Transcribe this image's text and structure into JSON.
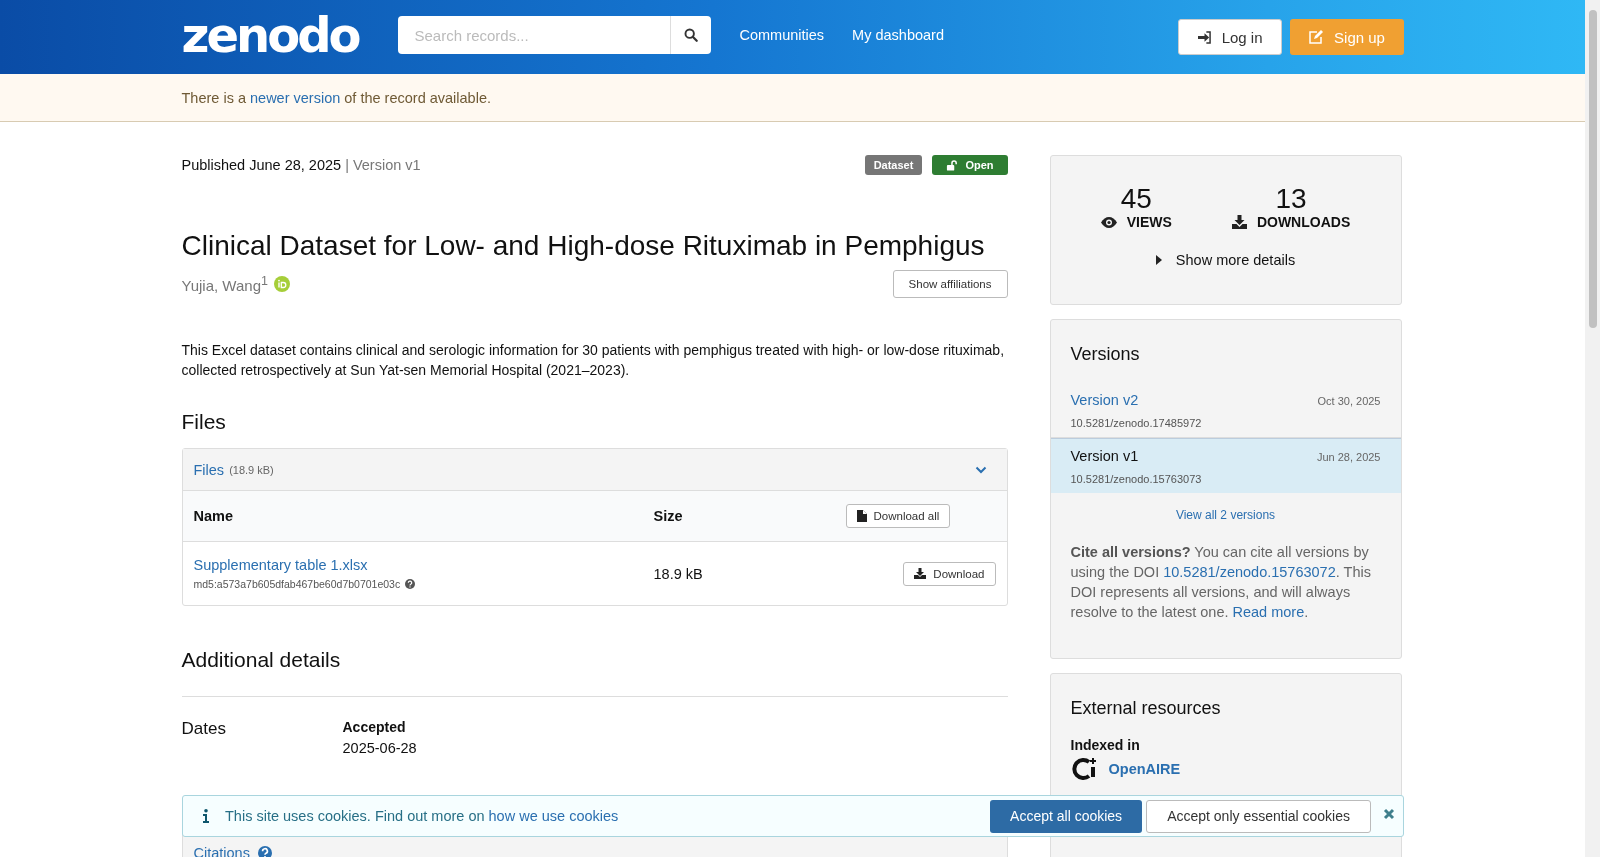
{
  "header": {
    "logo": "zenodo",
    "search": {
      "placeholder": "Search records..."
    },
    "nav": [
      "Communities",
      "My dashboard"
    ],
    "login": "Log in",
    "signup": "Sign up"
  },
  "notice": {
    "before": "There is a",
    "link": "newer version",
    "after": "of the record available."
  },
  "record": {
    "published": "Published June 28, 2025",
    "version": "| Version v1",
    "badges": [
      {
        "label": "Dataset",
        "kind": "type"
      },
      {
        "label": "Open",
        "kind": "access"
      }
    ],
    "title": "Clinical Dataset for Low- and High-dose Rituximab in Pemphigus",
    "author": "Yujia, Wang$^{1}$",
    "show_affiliations": "Show affiliations",
    "description": "This Excel dataset contains clinical and serologic information for 30 patients with pemphigus treated with high- or low-dose rituximab, collected retrospectively at Sun Yat-sen Memorial Hospital (2021–2023)."
  },
  "files": {
    "heading": "Files",
    "panel_title": "Files",
    "panel_size": "(18.9 kB)",
    "expanded": true,
    "columns": [
      "Name",
      "Size"
    ],
    "download_all": "Download all",
    "rows": [
      {
        "name": "Supplementary table 1.xlsx",
        "checksum": "md5:a573a7b605dfab467be60d7b0701e03c",
        "size": "18.9 kB",
        "action": "Download"
      }
    ]
  },
  "additional": {
    "heading": "Additional details",
    "dates_label": "Dates",
    "date_type": "Accepted",
    "date_value": "2025-06-28",
    "citations": "Citations"
  },
  "stats": {
    "items": [
      {
        "value": "45",
        "label": "VIEWS",
        "kind": "views"
      },
      {
        "value": "13",
        "label": "DOWNLOADS",
        "kind": "downloads"
      }
    ],
    "more": "Show more details"
  },
  "versions": {
    "heading": "Versions",
    "items": [
      {
        "label": "Version v2",
        "date": "Oct 30, 2025",
        "doi": "10.5281/zenodo.17485972",
        "selected": false
      },
      {
        "label": "Version v1",
        "date": "Jun 28, 2025",
        "doi": "10.5281/zenodo.15763073",
        "selected": true
      }
    ],
    "view_all": "View all 2 versions",
    "cite_bold": "Cite all versions?",
    "cite_text1": "You can cite all versions by using the DOI",
    "cite_doi": "10.5281/zenodo.15763072",
    "cite_text2": ". This DOI represents all versions, and will always resolve to the latest one.",
    "read_more": "Read more",
    "cite_end": "."
  },
  "external": {
    "heading": "External resources",
    "indexed": "Indexed in",
    "source": "OpenAIRE"
  },
  "cookies": {
    "text": "This site uses cookies. Find out more on",
    "link": "how we use cookies",
    "accept_all": "Accept all cookies",
    "accept_essential": "Accept only essential cookies"
  }
}
